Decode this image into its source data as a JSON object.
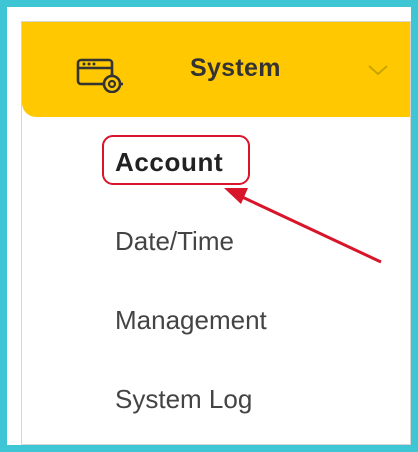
{
  "header": {
    "title": "System",
    "icon": "system-settings-icon",
    "expand_icon": "chevron-down-icon",
    "background_color": "#ffc800"
  },
  "menu": {
    "items": [
      {
        "label": "Account",
        "active": true
      },
      {
        "label": "Date/Time",
        "active": false
      },
      {
        "label": "Management",
        "active": false
      },
      {
        "label": "System Log",
        "active": false
      }
    ]
  },
  "annotation": {
    "highlight_color": "#d8152a",
    "frame_color": "#3ec6d4"
  }
}
